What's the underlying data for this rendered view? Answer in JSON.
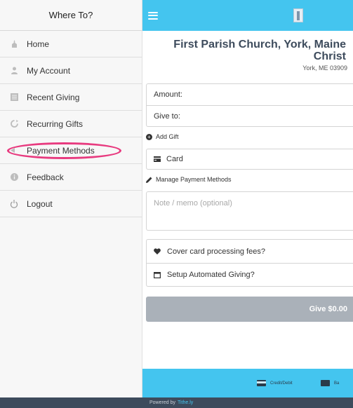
{
  "sidebar": {
    "title": "Where To?",
    "items": [
      {
        "label": "Home",
        "icon": "church-icon"
      },
      {
        "label": "My Account",
        "icon": "user-icon"
      },
      {
        "label": "Recent Giving",
        "icon": "list-icon"
      },
      {
        "label": "Recurring Gifts",
        "icon": "refresh-icon"
      },
      {
        "label": "Payment Methods",
        "icon": "pointer-icon"
      },
      {
        "label": "Feedback",
        "icon": "info-icon"
      },
      {
        "label": "Logout",
        "icon": "power-icon"
      }
    ],
    "highlight_color": "#e83a7f"
  },
  "topbar": {
    "color": "#44c5ef"
  },
  "organization": {
    "name": "First Parish Church, York, Maine Christ",
    "location": "York, ME 03909"
  },
  "form": {
    "amount_label": "Amount:",
    "give_to_label": "Give to:",
    "add_gift": "Add Gift",
    "payment_type": "Card",
    "manage_payment": "Manage Payment Methods",
    "memo_placeholder": "Note / memo (optional)",
    "cover_fees": "Cover card processing fees?",
    "setup_automated": "Setup Automated Giving?",
    "give_button": "Give $0.00"
  },
  "bottom_tabs": {
    "credit": "Credit/Debit",
    "bank": "Ba"
  },
  "footer": {
    "powered_by": "Powered by",
    "brand": "Tithe.ly"
  }
}
